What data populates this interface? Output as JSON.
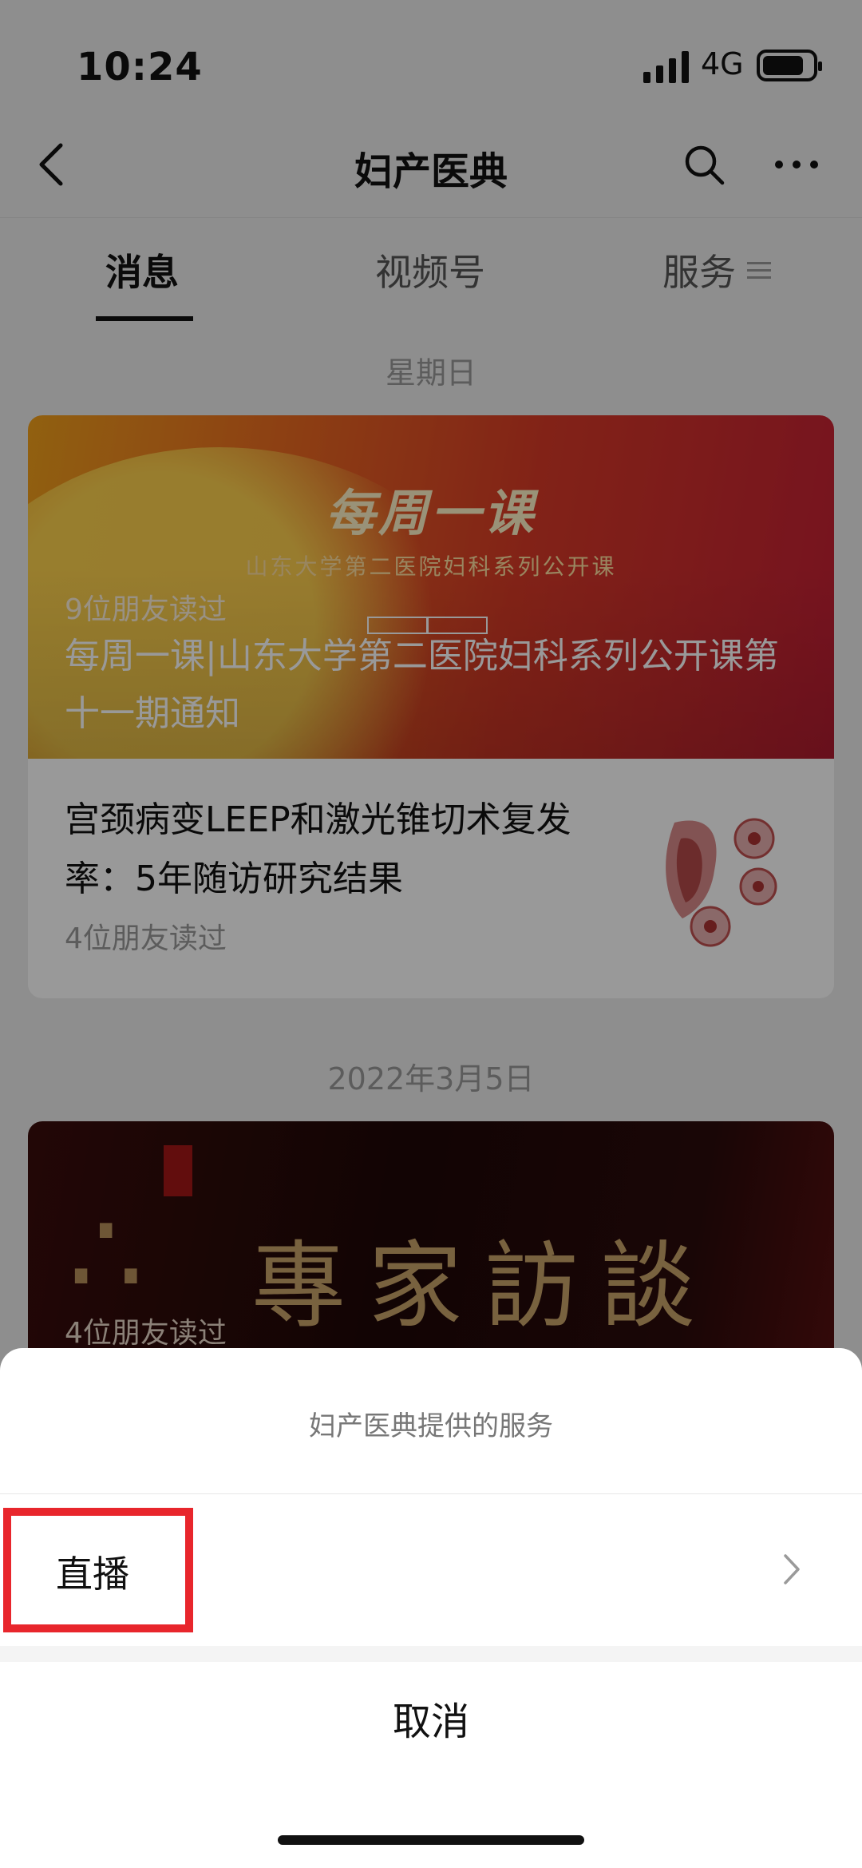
{
  "status_bar": {
    "time": "10:24",
    "network": "4G"
  },
  "nav": {
    "title": "妇产医典"
  },
  "tabs": [
    {
      "label": "消息",
      "active": true
    },
    {
      "label": "视频号",
      "active": false
    },
    {
      "label": "服务",
      "active": false
    }
  ],
  "feed": {
    "groups": [
      {
        "date": "星期日",
        "cover": {
          "title": "每周一课",
          "subtitle": "山东大学第二医院妇科系列公开课",
          "reads": "9位朋友读过",
          "headline": "每周一课|山东大学第二医院妇科系列公开课第十一期通知"
        },
        "items": [
          {
            "title": "宫颈病变LEEP和激光锥切术复发率：5年随访研究结果",
            "reads": "4位朋友读过"
          }
        ]
      },
      {
        "date": "2022年3月5日",
        "cover": {
          "title": "專家訪談",
          "reads": "4位朋友读过"
        }
      }
    ]
  },
  "sheet": {
    "title": "妇产医典提供的服务",
    "items": [
      {
        "label": "直播"
      }
    ],
    "cancel": "取消"
  },
  "colors": {
    "highlight": "#e8262c",
    "dim_overlay": "rgba(0,0,0,0.40)"
  }
}
